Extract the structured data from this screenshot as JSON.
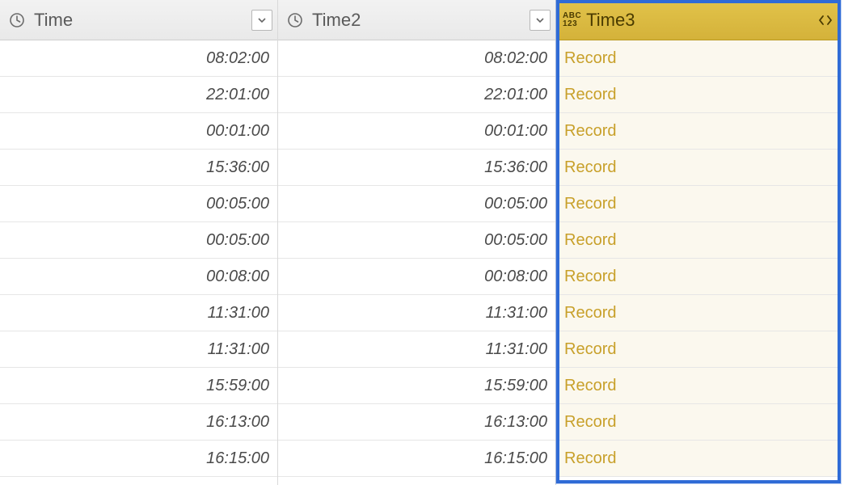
{
  "columns": {
    "col1": {
      "label": "Time",
      "type": "time"
    },
    "col2": {
      "label": "Time2",
      "type": "time"
    },
    "col3": {
      "label": "Time3",
      "type": "any",
      "selected": true
    }
  },
  "type_badge": {
    "line1": "ABC",
    "line2": "123"
  },
  "rows": [
    {
      "time": "08:02:00",
      "time2": "08:02:00",
      "time3": "Record"
    },
    {
      "time": "22:01:00",
      "time2": "22:01:00",
      "time3": "Record"
    },
    {
      "time": "00:01:00",
      "time2": "00:01:00",
      "time3": "Record"
    },
    {
      "time": "15:36:00",
      "time2": "15:36:00",
      "time3": "Record"
    },
    {
      "time": "00:05:00",
      "time2": "00:05:00",
      "time3": "Record"
    },
    {
      "time": "00:05:00",
      "time2": "00:05:00",
      "time3": "Record"
    },
    {
      "time": "00:08:00",
      "time2": "00:08:00",
      "time3": "Record"
    },
    {
      "time": "11:31:00",
      "time2": "11:31:00",
      "time3": "Record"
    },
    {
      "time": "11:31:00",
      "time2": "11:31:00",
      "time3": "Record"
    },
    {
      "time": "15:59:00",
      "time2": "15:59:00",
      "time3": "Record"
    },
    {
      "time": "16:13:00",
      "time2": "16:13:00",
      "time3": "Record"
    },
    {
      "time": "16:15:00",
      "time2": "16:15:00",
      "time3": "Record"
    }
  ]
}
